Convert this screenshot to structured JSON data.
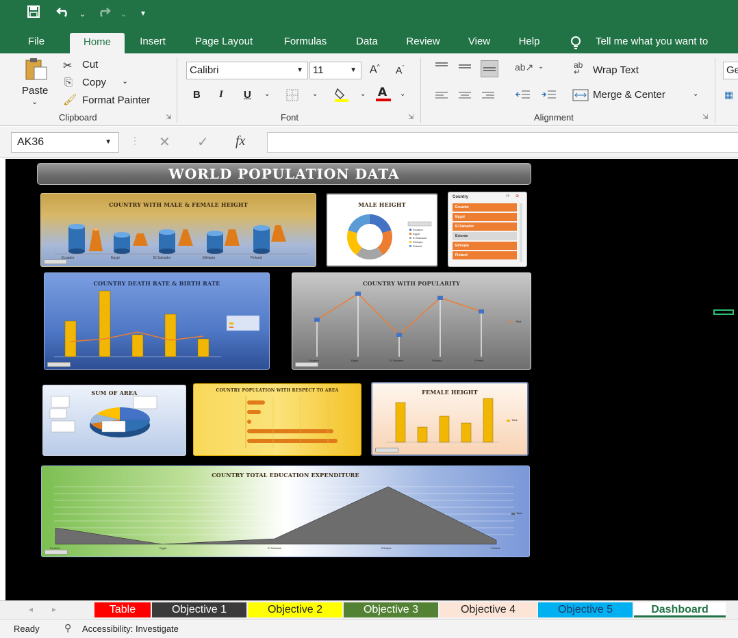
{
  "ribbon_tabs": [
    "File",
    "Home",
    "Insert",
    "Page Layout",
    "Formulas",
    "Data",
    "Review",
    "View",
    "Help"
  ],
  "tell_me": "Tell me what you want to",
  "clipboard": {
    "paste": "Paste",
    "cut": "Cut",
    "copy": "Copy",
    "format_painter": "Format Painter",
    "label": "Clipboard"
  },
  "font": {
    "name": "Calibri",
    "size": "11",
    "label": "Font",
    "bold": "B",
    "italic": "I",
    "underline": "U"
  },
  "alignment": {
    "wrap_text": "Wrap Text",
    "merge_center": "Merge & Center",
    "label": "Alignment"
  },
  "number_cut": "Ge",
  "formula_bar": {
    "name_box": "AK36",
    "fx": "fx",
    "formula": ""
  },
  "dashboard": {
    "title": "WORLD POPULATION DATA",
    "charts": {
      "male_female_height": "COUNTRY WITH MALE & FEMALE HEIGHT",
      "male_height": "MALE HEIGHT",
      "death_birth": "COUNTRY DEATH RATE & BIRTH RATE",
      "popularity": "COUNTRY WITH POPULARITY",
      "sum_area": "SUM OF AREA",
      "pop_area": "COUNTRY POPULATION WITH RESPECT TO AREA",
      "female_height": "FEMALE HEIGHT",
      "education": "COUNTRY TOTAL EDUCATION EXPENDITURE"
    },
    "slicer": {
      "header": "Country",
      "items": [
        "Ecuador",
        "Egypt",
        "El Salvador",
        "Estonia",
        "Ethiopia",
        "Finland"
      ]
    },
    "countries": [
      "Ecuador",
      "Egypt",
      "El Salvador",
      "Ethiopia",
      "Finland"
    ],
    "legend_total": "Total"
  },
  "sheet_tabs": [
    {
      "label": "Table",
      "bg": "#ff0000",
      "fg": "#ffffff"
    },
    {
      "label": "Objective 1",
      "bg": "#3a3a3a",
      "fg": "#ffffff"
    },
    {
      "label": "Objective 2",
      "bg": "#ffff00",
      "fg": "#222222"
    },
    {
      "label": "Objective 3",
      "bg": "#548235",
      "fg": "#ffffff"
    },
    {
      "label": "Objective 4",
      "bg": "#fce4d6",
      "fg": "#222222"
    },
    {
      "label": "Objective 5",
      "bg": "#00b0f0",
      "fg": "#1f3864"
    },
    {
      "label": "Dashboard",
      "bg": "#ffffff",
      "fg": "#217346"
    }
  ],
  "status": {
    "ready": "Ready",
    "accessibility": "Accessibility: Investigate"
  },
  "colors": {
    "excel_green": "#217346",
    "orange": "#ed7d31",
    "gold": "#f2b705"
  }
}
